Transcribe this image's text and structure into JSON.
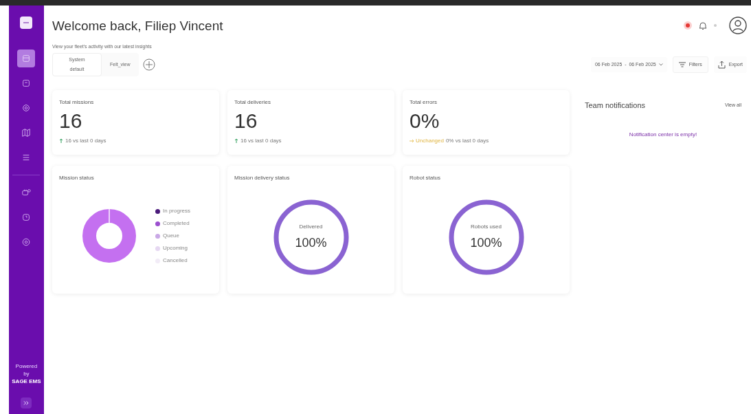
{
  "sidebar": {
    "items": [
      {
        "selected": true
      },
      {
        "selected": false
      },
      {
        "selected": false
      },
      {
        "selected": false
      },
      {
        "selected": false
      },
      {
        "selected": false
      },
      {
        "selected": false
      },
      {
        "selected": false
      }
    ],
    "footer": [
      "Powered",
      "by",
      "SAGE EMS"
    ]
  },
  "header": {
    "title": "Welcome back, Filiep Vincent",
    "subtitle": "View your fleet's activity with our latest insights",
    "views": [
      {
        "label": "System default",
        "selected": true
      },
      {
        "label": "Felt_view",
        "selected": false
      }
    ],
    "date_range": "06 Feb 2025  -  06 Feb 2025",
    "buttons": [
      "Filters",
      "Export"
    ]
  },
  "stats": [
    {
      "title": "Total missions",
      "value": "16",
      "kind": "up",
      "detail": "16 vs last 0 days"
    },
    {
      "title": "Total deliveries",
      "value": "16",
      "kind": "up",
      "detail": "16 vs last 0 days"
    },
    {
      "title": "Total errors",
      "value": "0%",
      "kind": "flat",
      "trend_text": "Unchanged",
      "detail": "0% vs last 0 days"
    }
  ],
  "mission_status": {
    "title": "Mission status",
    "legend": [
      {
        "label": "In progress",
        "color": "#4a1a7a"
      },
      {
        "label": "Completed",
        "color": "#9b4fcf"
      },
      {
        "label": "Queue",
        "color": "#c9a8e6"
      },
      {
        "label": "Upcoming",
        "color": "#e6d8f2"
      },
      {
        "label": "Cancelled",
        "color": "#f2ecf7"
      }
    ]
  },
  "rings": [
    {
      "title": "Mission delivery status",
      "label": "Delivered",
      "value": "100%",
      "level": 1
    },
    {
      "title": "Robot status",
      "label": "Robots used",
      "value": "100%",
      "level": 1
    }
  ],
  "notifications": {
    "title": "Team notifications",
    "link": "View all",
    "empty": "Notification center is empty!"
  }
}
